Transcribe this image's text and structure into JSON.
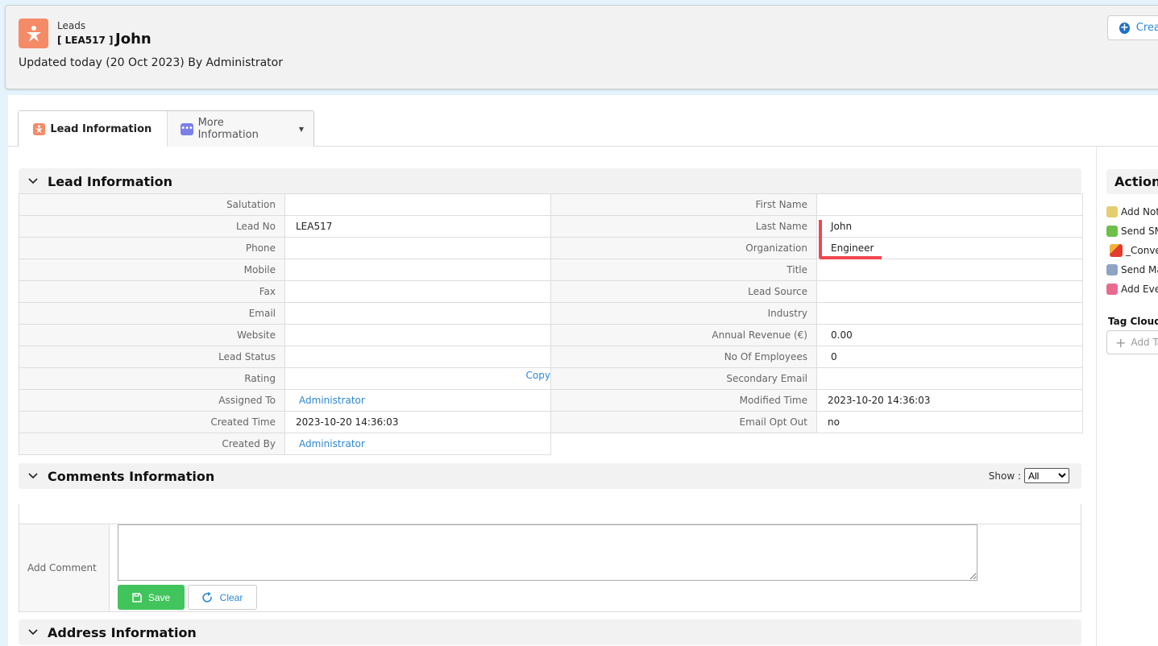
{
  "header": {
    "module": "Leads",
    "record_no": "[ LEA517 ]",
    "record_name": "John",
    "updated": "Updated today (20 Oct 2023) By Administrator",
    "create_button": "Create"
  },
  "tabs": [
    {
      "label": "Lead Information",
      "active": true
    },
    {
      "label": "More Information",
      "active": false
    }
  ],
  "lead_information": {
    "title": "Lead Information",
    "left_fields": [
      {
        "label": "Salutation",
        "value": ""
      },
      {
        "label": "Lead No",
        "value": "LEA517"
      },
      {
        "label": "Phone",
        "value": ""
      },
      {
        "label": "Mobile",
        "value": ""
      },
      {
        "label": "Fax",
        "value": ""
      },
      {
        "label": "Email",
        "value": ""
      },
      {
        "label": "Website",
        "value": ""
      },
      {
        "label": "Lead Status",
        "value": ""
      },
      {
        "label": "Rating",
        "value": "",
        "action": "Copy"
      },
      {
        "label": "Assigned To",
        "value": "Administrator"
      },
      {
        "label": "Created Time",
        "value": "2023-10-20 14:36:03"
      },
      {
        "label": "Created By",
        "value": "Administrator"
      }
    ],
    "right_fields": [
      {
        "label": "First Name",
        "value": ""
      },
      {
        "label": "Last Name",
        "value": "John"
      },
      {
        "label": "Organization",
        "value": "Engineer"
      },
      {
        "label": "Title",
        "value": ""
      },
      {
        "label": "Lead Source",
        "value": ""
      },
      {
        "label": "Industry",
        "value": ""
      },
      {
        "label": "Annual Revenue (€)",
        "value": "0.00"
      },
      {
        "label": "No Of Employees",
        "value": "0"
      },
      {
        "label": "Secondary Email",
        "value": ""
      },
      {
        "label": "Modified Time",
        "value": "2023-10-20 14:36:03"
      },
      {
        "label": "Email Opt Out",
        "value": "no"
      }
    ]
  },
  "comments": {
    "title": "Comments Information",
    "show_label": "Show :",
    "show_value": "All",
    "add_comment_label": "Add Comment",
    "comment_value": "",
    "save_label": "Save",
    "clear_label": "Clear"
  },
  "address": {
    "title": "Address Information"
  },
  "actions": {
    "title": "Actions",
    "items": [
      {
        "label": "Add Note",
        "icon": "note-icon",
        "color": "#e3cf6f"
      },
      {
        "label": "Send SMS",
        "icon": "sms-icon",
        "color": "#6cc04a"
      },
      {
        "label": "_Convert Lead",
        "icon": "convert-icon",
        "color": ""
      },
      {
        "label": "Send Mail",
        "icon": "mail-icon",
        "color": "#8fa4c4"
      },
      {
        "label": "Add Event",
        "icon": "calendar-icon",
        "color": "#e86b8f"
      }
    ]
  },
  "tag_cloud": {
    "title": "Tag Cloud",
    "add_label": "Add Tag"
  }
}
